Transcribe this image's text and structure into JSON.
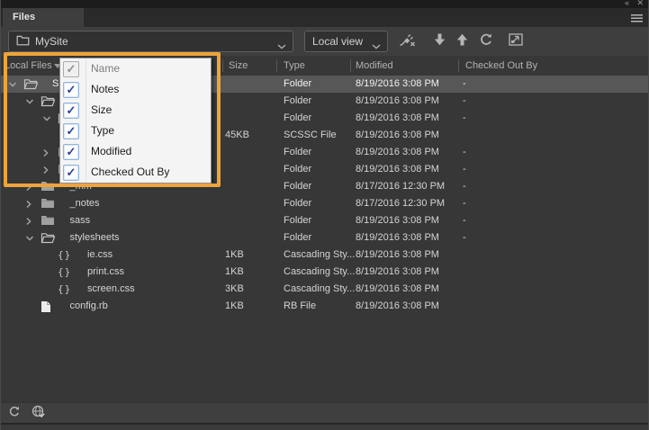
{
  "panel": {
    "tab_label": "Files",
    "titlebar": {
      "collapse_icon": "collapse-double-arrow-icon",
      "collapse_glyph": "«",
      "close_icon": "close-icon",
      "close_glyph": "✕",
      "panel_menu_icon": "hamburger-menu-icon"
    }
  },
  "toolbar": {
    "site_selector": {
      "value": "MySite",
      "icon": "folder-icon"
    },
    "view_selector": {
      "value": "Local view"
    },
    "buttons": [
      {
        "name": "connect-remote-server",
        "icon": "plug-x-icon"
      },
      {
        "name": "get-files",
        "icon": "down-arrow-icon"
      },
      {
        "name": "put-files",
        "icon": "up-arrow-icon"
      },
      {
        "name": "refresh",
        "icon": "refresh-icon"
      },
      {
        "name": "expand-panel",
        "icon": "expand-icon"
      }
    ]
  },
  "header": {
    "columns": [
      {
        "id": "local_files",
        "label": "Local Files",
        "sorted": true
      },
      {
        "id": "size",
        "label": "Size"
      },
      {
        "id": "type",
        "label": "Type"
      },
      {
        "id": "modified",
        "label": "Modified"
      },
      {
        "id": "checked_out_by",
        "label": "Checked Out By"
      }
    ]
  },
  "context_menu": {
    "items": [
      {
        "label": "Name",
        "checked": true,
        "disabled": true
      },
      {
        "label": "Notes",
        "checked": true,
        "disabled": false
      },
      {
        "label": "Size",
        "checked": true,
        "disabled": false
      },
      {
        "label": "Type",
        "checked": true,
        "disabled": false
      },
      {
        "label": "Modified",
        "checked": true,
        "disabled": false
      },
      {
        "label": "Checked Out By",
        "checked": true,
        "disabled": false
      }
    ],
    "check_glyph": "✓"
  },
  "files": {
    "rows": [
      {
        "name": "S",
        "level": 0,
        "icon": "folder-open",
        "expander": "down",
        "size": "",
        "type": "Folder",
        "modified": "8/19/2016 3:08 PM",
        "checked_out": "-",
        "selected": true
      },
      {
        "name": "",
        "level": 1,
        "icon": "folder-open",
        "expander": "down",
        "size": "",
        "type": "Folder",
        "modified": "8/19/2016 3:08 PM",
        "checked_out": "-",
        "selected": false
      },
      {
        "name": "",
        "level": 2,
        "icon": "folder-open",
        "expander": "down",
        "size": "",
        "type": "Folder",
        "modified": "8/19/2016 3:08 PM",
        "checked_out": "-",
        "selected": false
      },
      {
        "name": "",
        "level": 3,
        "icon": "braces",
        "expander": "none",
        "size": "45KB",
        "type": "SCSSC File",
        "modified": "8/19/2016 3:08 PM",
        "checked_out": "",
        "selected": false
      },
      {
        "name": "",
        "level": 2,
        "icon": "folder-closed",
        "expander": "right",
        "size": "",
        "type": "Folder",
        "modified": "8/19/2016 3:08 PM",
        "checked_out": "-",
        "selected": false
      },
      {
        "name": "",
        "level": 2,
        "icon": "folder-closed",
        "expander": "right",
        "size": "",
        "type": "Folder",
        "modified": "8/19/2016 3:08 PM",
        "checked_out": "-",
        "selected": false
      },
      {
        "name": "_mm",
        "level": 1,
        "icon": "folder-closed",
        "expander": "right",
        "size": "",
        "type": "Folder",
        "modified": "8/17/2016 12:30 PM",
        "checked_out": "-",
        "selected": false
      },
      {
        "name": "_notes",
        "level": 1,
        "icon": "folder-closed",
        "expander": "right",
        "size": "",
        "type": "Folder",
        "modified": "8/17/2016 12:30 PM",
        "checked_out": "-",
        "selected": false
      },
      {
        "name": "sass",
        "level": 1,
        "icon": "folder-closed",
        "expander": "right",
        "size": "",
        "type": "Folder",
        "modified": "8/19/2016 3:08 PM",
        "checked_out": "-",
        "selected": false
      },
      {
        "name": "stylesheets",
        "level": 1,
        "icon": "folder-open",
        "expander": "down",
        "size": "",
        "type": "Folder",
        "modified": "8/19/2016 3:08 PM",
        "checked_out": "-",
        "selected": false
      },
      {
        "name": "ie.css",
        "level": 2,
        "icon": "braces",
        "expander": "none",
        "size": "1KB",
        "type": "Cascading Sty...",
        "modified": "8/19/2016 3:08 PM",
        "checked_out": "",
        "selected": false
      },
      {
        "name": "print.css",
        "level": 2,
        "icon": "braces",
        "expander": "none",
        "size": "1KB",
        "type": "Cascading Sty...",
        "modified": "8/19/2016 3:08 PM",
        "checked_out": "",
        "selected": false
      },
      {
        "name": "screen.css",
        "level": 2,
        "icon": "braces",
        "expander": "none",
        "size": "3KB",
        "type": "Cascading Sty...",
        "modified": "8/19/2016 3:08 PM",
        "checked_out": "",
        "selected": false
      },
      {
        "name": "config.rb",
        "level": 1,
        "icon": "page",
        "expander": "none",
        "size": "1KB",
        "type": "RB File",
        "modified": "8/19/2016 3:08 PM",
        "checked_out": "",
        "selected": false
      }
    ]
  },
  "status_bar": {
    "buttons": [
      {
        "name": "refresh",
        "icon": "refresh-icon"
      },
      {
        "name": "synchronize",
        "icon": "globe-check-icon"
      }
    ]
  },
  "colors": {
    "annotation_orange": "#EDA43C",
    "menu_check_blue": "#2B3E9A",
    "selected_row_gray": "#575757",
    "panel_background": "#373737"
  }
}
